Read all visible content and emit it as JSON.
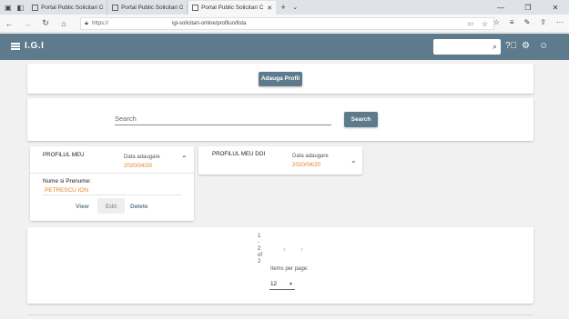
{
  "browser": {
    "tabs": [
      {
        "title": "Portal Public Solicitari Onlin"
      },
      {
        "title": "Portal Public Solicitari Onlin"
      },
      {
        "title": "Portal Public Solicitari C"
      }
    ],
    "new_tab": "+",
    "url_protocol": "https://",
    "url_host": "igi-solicitari-online/profilun/lista"
  },
  "appbar": {
    "brand": "I.G.I",
    "search_placeholder": ""
  },
  "toolbar": {
    "add_profile_label": "Adauga Profil"
  },
  "search": {
    "label": "Search",
    "button_label": "Search"
  },
  "profiles": [
    {
      "title": "PROFILUL MEU",
      "date_label": "Data adaugare",
      "date": "2020/04/20",
      "expanded": true,
      "field_label": "Nume si Prenume:",
      "field_value": "PETRESCU ION",
      "actions": [
        "View",
        "Edit",
        "Delete"
      ]
    },
    {
      "title": "PROFILUL MEU DOI",
      "date_label": "Data adaugare",
      "date": "2020/04/20",
      "expanded": false
    }
  ],
  "pagination": {
    "range_lines": [
      "1",
      "-",
      "2",
      "of",
      "2"
    ],
    "items_per_page_label": "Items per page:",
    "items_per_page_value": "12"
  },
  "colors": {
    "primary": "#5d7b8d",
    "accent_date": "#e67e22"
  }
}
